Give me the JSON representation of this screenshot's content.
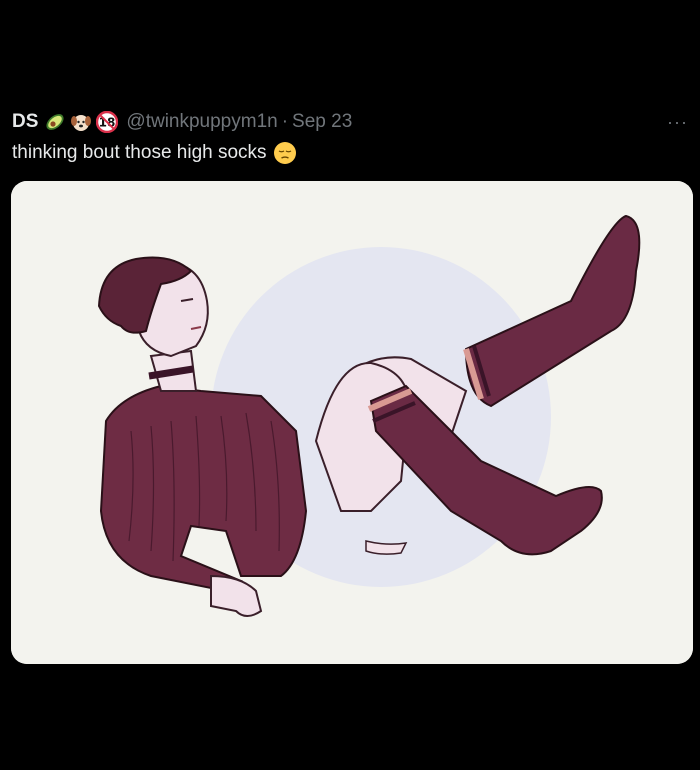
{
  "tweet": {
    "display_name": "DS",
    "handle": "@twinkpuppym1n",
    "separator": "·",
    "date": "Sep 23",
    "text": "thinking bout those high socks",
    "badges": [
      "avocado-emoji",
      "puppy-emoji",
      "18-emoji"
    ],
    "text_emoji": "pensive-face-emoji",
    "more_label": "···"
  },
  "media": {
    "description_icon": "illustration",
    "colors": {
      "background": "#f3f3ee",
      "circle": "#e4e6f1",
      "sweater": "#6e2c44",
      "socks": "#6a2a44",
      "skin": "#f2e2ea",
      "hair": "#5a2337",
      "stripe": "#d99a93"
    }
  }
}
